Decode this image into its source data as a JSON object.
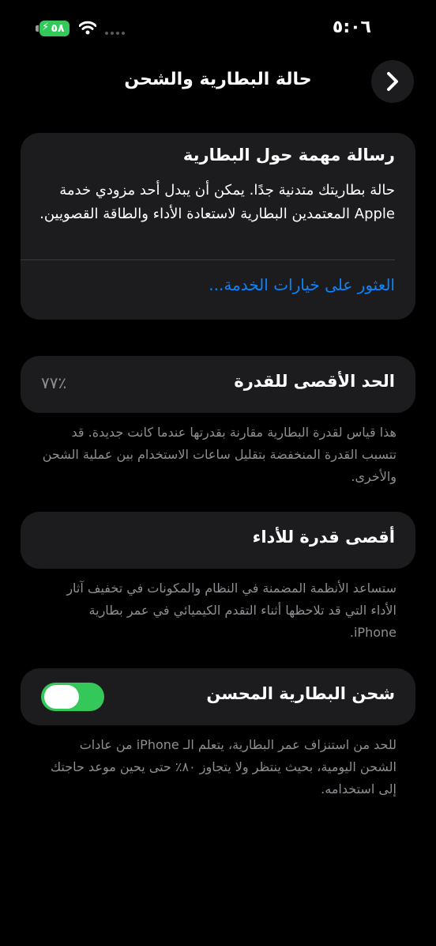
{
  "status_bar": {
    "time": "٥:٠٦",
    "battery_level": "٥٨"
  },
  "header": {
    "title": "حالة البطارية والشحن"
  },
  "important_message": {
    "title": "رسالة مهمة حول البطارية",
    "body": "حالة بطاريتك متدنية جدًا. يمكن أن يبدل أحد مزودي خدمة Apple المعتمدين البطارية لاستعادة الأداء والطاقة القصويين.",
    "link": "العثور على خيارات الخدمة..."
  },
  "maximum_capacity": {
    "label": "الحد الأقصى للقدرة",
    "value": "٪٧٧",
    "footnote": "هذا قياس لقدرة البطارية مقارنة بقدرتها عندما كانت جديدة. قد تتسبب القدرة المنخفضة بتقليل ساعات الاستخدام بين عملية الشحن والأخرى."
  },
  "peak_performance": {
    "label": "أقصى قدرة للأداء",
    "footnote": "ستساعد الأنظمة المضمنة في النظام والمكونات في تخفيف آثار الأداء التي قد تلاحظها أثناء التقدم الكيميائي في عمر بطارية iPhone."
  },
  "optimized_charging": {
    "label": "شحن البطارية المحسن",
    "enabled": true,
    "footnote": "للحد من استنزاف عمر البطارية، يتعلم الـ iPhone من عادات الشحن اليومية، بحيث ينتظر ولا يتجاوز ٨٠٪ حتى يحين موعد حاجتك إلى استخدامه."
  },
  "colors": {
    "background": "#000000",
    "card": "#1c1c1e",
    "accent_blue": "#0a84ff",
    "toggle_on": "#34c759",
    "secondary_text": "#8e8e93"
  },
  "icons": {
    "back": "chevron-right-icon",
    "wifi": "wifi-icon",
    "battery": "battery-charging-icon",
    "signal": "cellular-signal-icon"
  }
}
